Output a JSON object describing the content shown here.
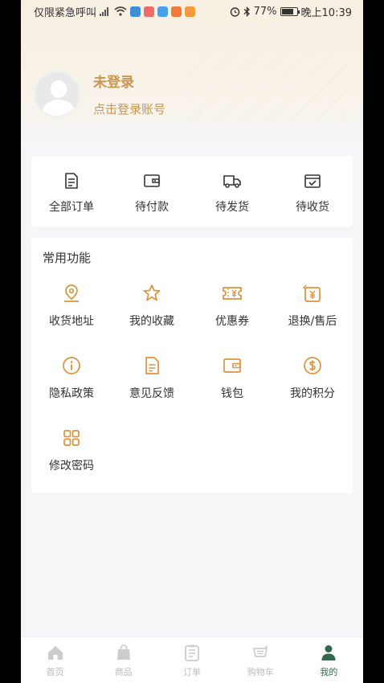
{
  "status_bar": {
    "carrier": "仅限紧急呼叫",
    "battery": "77%",
    "time": "晚上10:39"
  },
  "profile": {
    "name": "未登录",
    "subtitle": "点击登录账号"
  },
  "orders": [
    {
      "label": "全部订单",
      "icon": "document-icon"
    },
    {
      "label": "待付款",
      "icon": "wallet-icon"
    },
    {
      "label": "待发货",
      "icon": "truck-icon"
    },
    {
      "label": "待收货",
      "icon": "box-check-icon"
    }
  ],
  "functions": {
    "title": "常用功能",
    "items": [
      {
        "label": "收货地址",
        "icon": "map-pin-icon"
      },
      {
        "label": "我的收藏",
        "icon": "star-icon"
      },
      {
        "label": "优惠券",
        "icon": "coupon-icon"
      },
      {
        "label": "退换/售后",
        "icon": "refund-icon"
      },
      {
        "label": "隐私政策",
        "icon": "info-icon"
      },
      {
        "label": "意见反馈",
        "icon": "feedback-icon"
      },
      {
        "label": "钱包",
        "icon": "wallet-icon"
      },
      {
        "label": "我的积分",
        "icon": "coin-icon"
      },
      {
        "label": "修改密码",
        "icon": "grid-icon"
      }
    ]
  },
  "tabbar": [
    {
      "label": "首页",
      "icon": "home-icon",
      "active": false
    },
    {
      "label": "商品",
      "icon": "bag-icon",
      "active": false
    },
    {
      "label": "订单",
      "icon": "clipboard-icon",
      "active": false
    },
    {
      "label": "购物车",
      "icon": "cart-icon",
      "active": false
    },
    {
      "label": "我的",
      "icon": "person-icon",
      "active": true
    }
  ],
  "colors": {
    "accent": "#c8964f",
    "icon_orange": "#e0913a",
    "active_tab": "#2f6a4a",
    "inactive_tab": "#cccccc"
  }
}
